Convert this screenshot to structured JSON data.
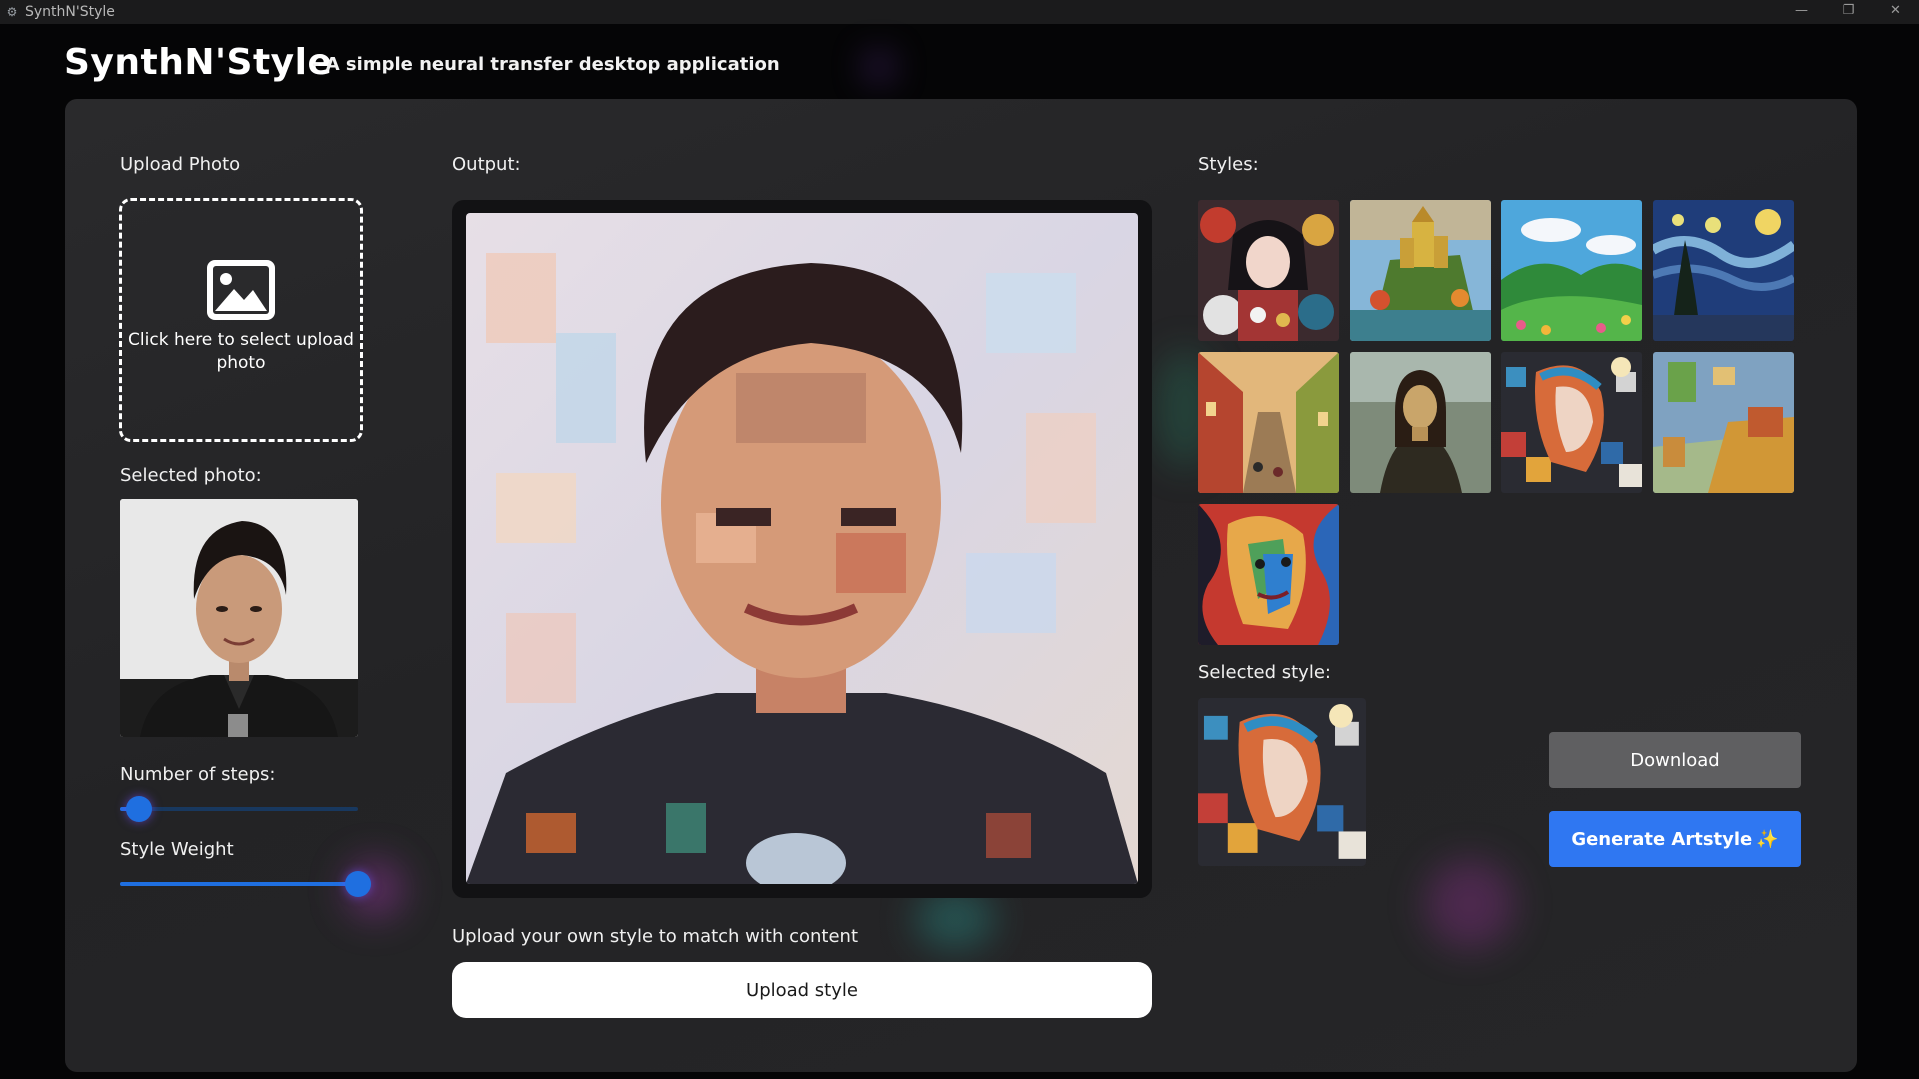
{
  "window": {
    "title": "SynthN'Style",
    "app_icon": "gear-icon",
    "controls": [
      "minimize-icon",
      "restore-icon",
      "close-icon"
    ]
  },
  "header": {
    "brand": "SynthN'Style",
    "tagline": "- A simple neural transfer desktop application"
  },
  "upload_photo": {
    "label": "Upload Photo",
    "drop_text": "Click here to select upload photo",
    "icon": "image-icon"
  },
  "selected_photo": {
    "label": "Selected photo:"
  },
  "steps": {
    "label": "Number of steps:",
    "value_fraction": 0.08
  },
  "style_weight": {
    "label": "Style Weight",
    "value_fraction": 1.0
  },
  "output": {
    "label": "Output:"
  },
  "upload_style": {
    "label": "Upload your own style to match with content",
    "button": "Upload style"
  },
  "styles": {
    "label": "Styles:",
    "items": [
      "anime-floral",
      "castle-landscape",
      "green-hills",
      "starry-night",
      "painted-street",
      "mona-lisa",
      "cubist-woman",
      "bedroom-in-arles",
      "abstract-face"
    ]
  },
  "selected_style": {
    "label": "Selected style:"
  },
  "actions": {
    "download": "Download",
    "generate": "Generate Artstyle",
    "generate_icon": "sparkles-icon"
  },
  "colors": {
    "accent": "#2f77f2",
    "slider_track": "#18385f",
    "panel": "#262628",
    "background": "#050506"
  }
}
